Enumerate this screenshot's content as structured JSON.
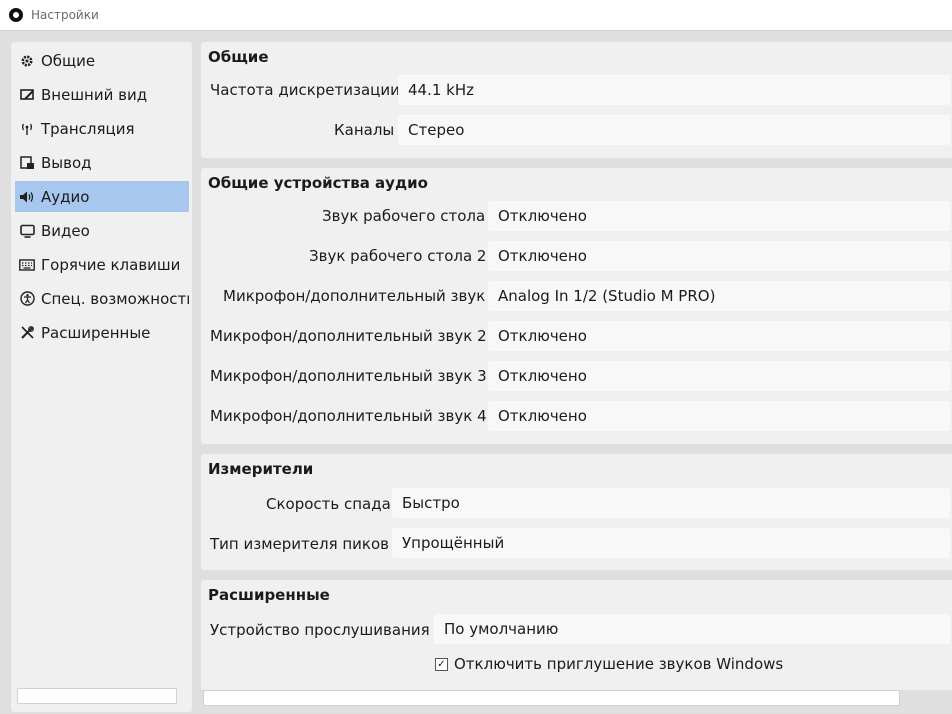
{
  "window": {
    "title": "Настройки"
  },
  "sidebar": {
    "items": [
      {
        "label": "Общие",
        "icon": "gear-icon"
      },
      {
        "label": "Внешний вид",
        "icon": "appearance-icon"
      },
      {
        "label": "Трансляция",
        "icon": "broadcast-icon"
      },
      {
        "label": "Вывод",
        "icon": "output-icon"
      },
      {
        "label": "Аудио",
        "icon": "speaker-icon",
        "selected": true
      },
      {
        "label": "Видео",
        "icon": "monitor-icon"
      },
      {
        "label": "Горячие клавиши",
        "icon": "keyboard-icon"
      },
      {
        "label": "Спец. возможности",
        "icon": "accessibility-icon"
      },
      {
        "label": "Расширенные",
        "icon": "wrench-icon"
      }
    ],
    "selected_color": "#a7c7ee"
  },
  "general": {
    "title": "Общие",
    "sample_rate_label": "Частота дискретизации",
    "sample_rate_value": "44.1 kHz",
    "channels_label": "Каналы",
    "channels_value": "Стерео"
  },
  "devices": {
    "title": "Общие устройства аудио",
    "rows": [
      {
        "label": "Звук рабочего стола",
        "value": "Отключено"
      },
      {
        "label": "Звук рабочего стола 2",
        "value": "Отключено"
      },
      {
        "label": "Микрофон/дополнительный звук",
        "value": "Analog In 1/2 (Studio M PRO)"
      },
      {
        "label": "Микрофон/дополнительный звук 2",
        "value": "Отключено"
      },
      {
        "label": "Микрофон/дополнительный звук 3",
        "value": "Отключено"
      },
      {
        "label": "Микрофон/дополнительный звук 4",
        "value": "Отключено"
      }
    ]
  },
  "meters": {
    "title": "Измерители",
    "decay_label": "Скорость спада",
    "decay_value": "Быстро",
    "peak_label": "Тип измерителя пиков",
    "peak_value": "Упрощённый"
  },
  "advanced": {
    "title": "Расширенные",
    "monitor_label": "Устройство прослушивания",
    "monitor_value": "По умолчанию",
    "ducking_label": "Отключить приглушение звуков Windows",
    "ducking_checked": true
  }
}
